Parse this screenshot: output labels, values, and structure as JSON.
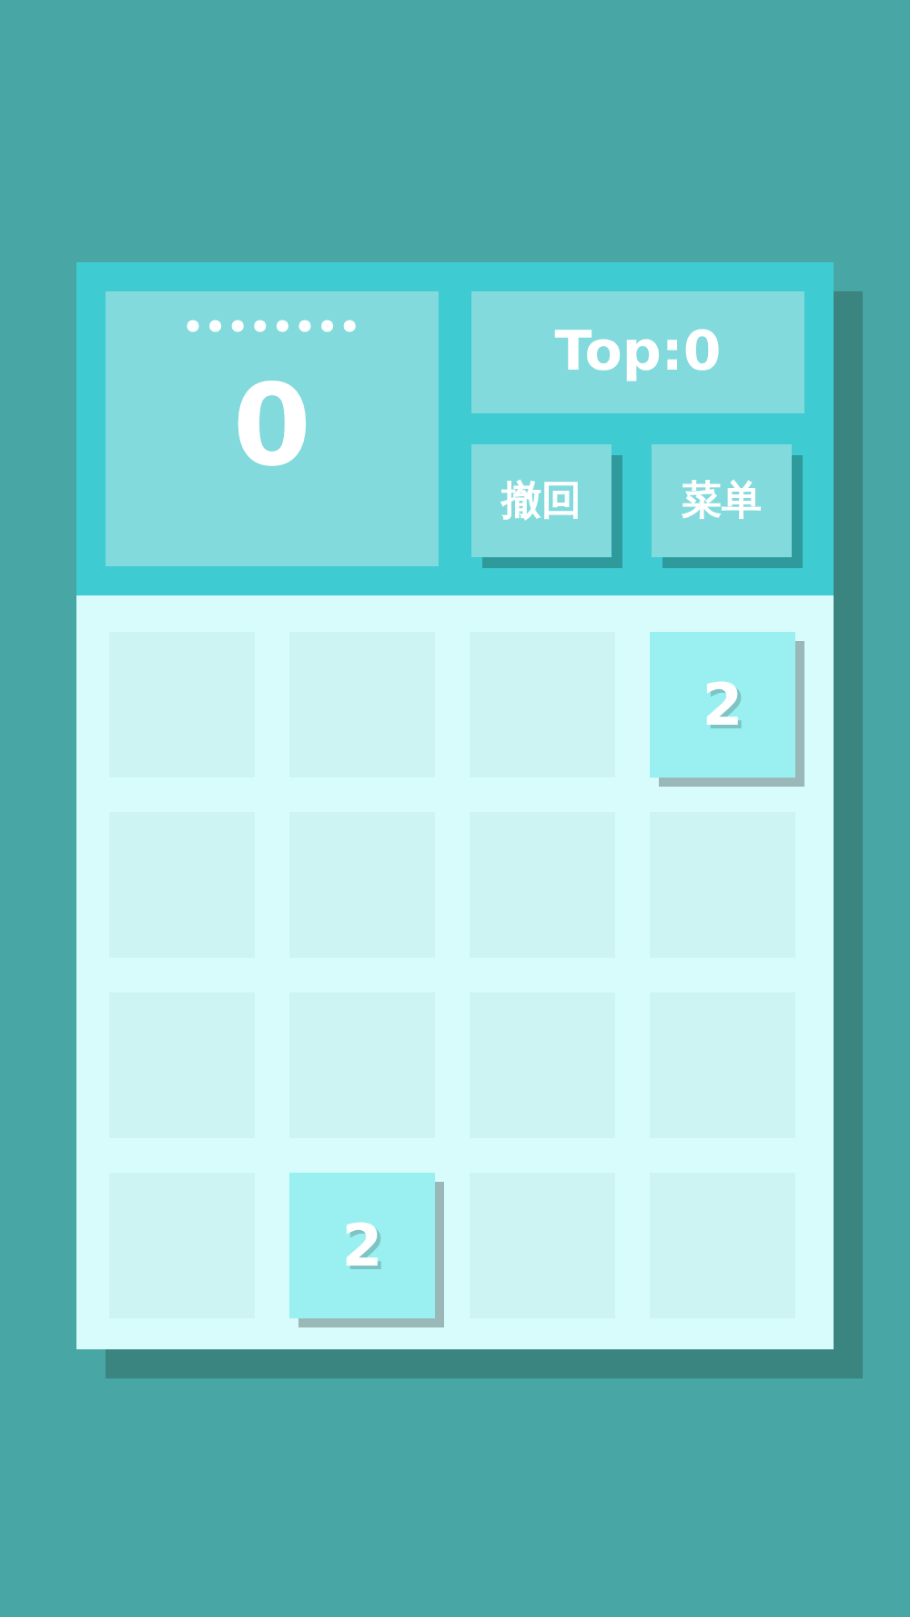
{
  "score": {
    "value": "0"
  },
  "best": {
    "label": "Top:0"
  },
  "buttons": [
    "撤回",
    "菜单"
  ],
  "board": [
    [
      {
        "kind": "empty"
      },
      {
        "kind": "empty"
      },
      {
        "kind": "empty"
      },
      {
        "kind": "tile",
        "value": "2"
      }
    ],
    [
      {
        "kind": "empty"
      },
      {
        "kind": "empty"
      },
      {
        "kind": "empty"
      },
      {
        "kind": "empty"
      }
    ],
    [
      {
        "kind": "empty"
      },
      {
        "kind": "empty"
      },
      {
        "kind": "empty"
      },
      {
        "kind": "empty"
      }
    ],
    [
      {
        "kind": "empty"
      },
      {
        "kind": "tile",
        "value": "2"
      },
      {
        "kind": "empty"
      },
      {
        "kind": "empty"
      }
    ]
  ]
}
